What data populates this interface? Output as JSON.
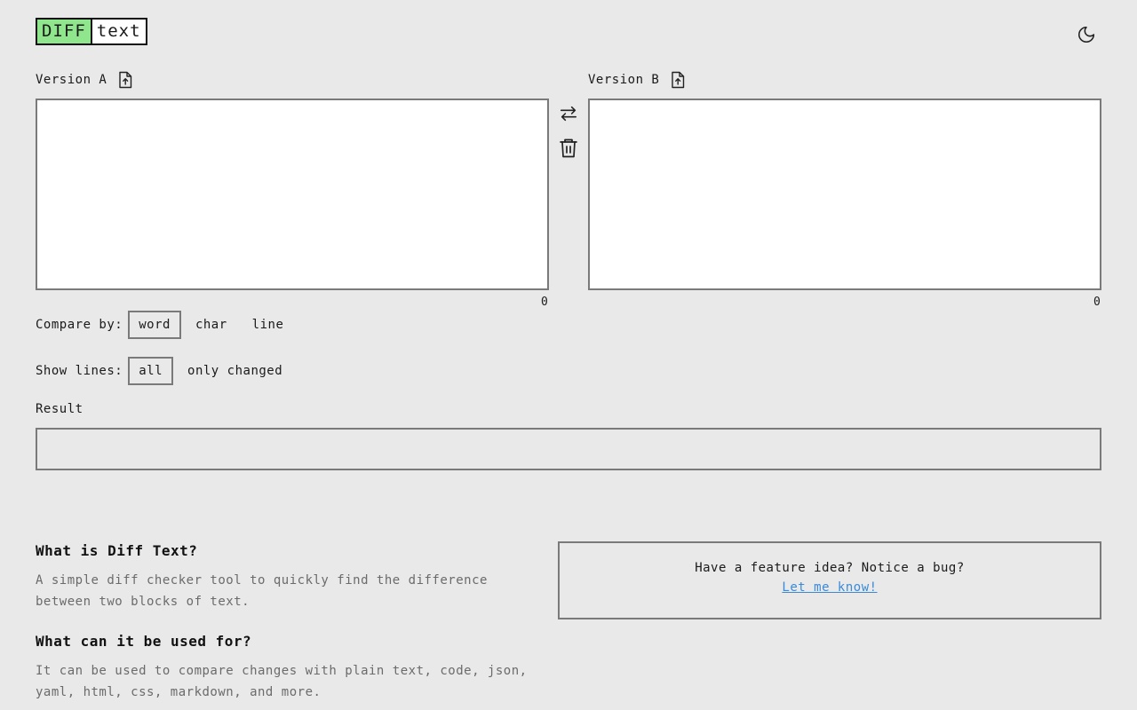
{
  "logo": {
    "part1": "DIFF",
    "part2": "text"
  },
  "header": {
    "theme_icon": "moon-icon"
  },
  "editor_a": {
    "label": "Version A",
    "icon": "file-upload-icon",
    "value": "",
    "char_count": "0"
  },
  "editor_b": {
    "label": "Version B",
    "icon": "file-upload-icon",
    "value": "",
    "char_count": "0"
  },
  "actions": {
    "swap_icon": "swap-arrows-icon",
    "clear_icon": "trash-icon"
  },
  "compare_by": {
    "label": "Compare by:",
    "options": [
      "word",
      "char",
      "line"
    ],
    "selected": "word"
  },
  "show_lines": {
    "label": "Show lines:",
    "options": [
      "all",
      "only changed"
    ],
    "selected": "all"
  },
  "result": {
    "label": "Result",
    "value": ""
  },
  "faq": [
    {
      "question": "What is Diff Text?",
      "answer": "A simple diff checker tool to quickly find the difference between two blocks of text."
    },
    {
      "question": "What can it be used for?",
      "answer": "It can be used to compare changes with plain text, code, json, yaml, html, css, markdown, and more."
    }
  ],
  "feedback": {
    "text": "Have a feature idea? Notice a bug?",
    "link": "Let me know!"
  },
  "colors": {
    "logo_accent": "#90e68c",
    "link": "#3a8ad8",
    "border": "#7a7a7a",
    "background": "#e9e9e9"
  }
}
